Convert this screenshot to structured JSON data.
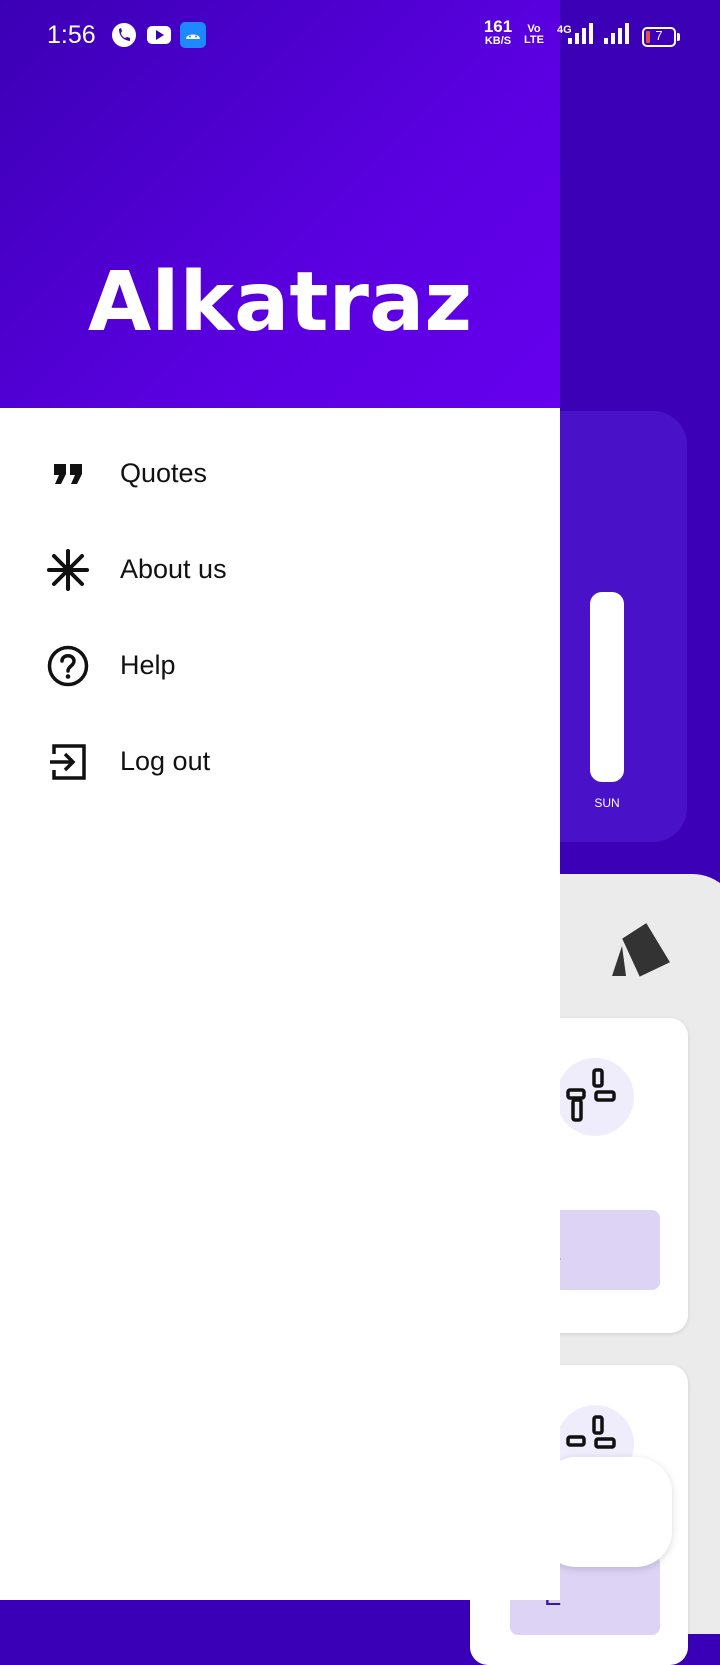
{
  "status_bar": {
    "time": "1:56",
    "network_speed_value": "161",
    "network_speed_unit": "KB/S",
    "volte_top": "Vo",
    "volte_bottom": "LTE",
    "network_type": "4G",
    "battery": "7"
  },
  "drawer": {
    "app_name": "Alkatraz",
    "items": [
      {
        "label": "Quotes",
        "icon": "quote-icon"
      },
      {
        "label": "About us",
        "icon": "asterisk-icon"
      },
      {
        "label": "Help",
        "icon": "help-circle-icon"
      },
      {
        "label": "Log out",
        "icon": "logout-icon"
      }
    ]
  },
  "background": {
    "chart_day_label": "SUN",
    "task_button_letter": "E",
    "task_button_letter_2": "E"
  },
  "colors": {
    "primary": "#3c00b6",
    "header_gradient_end": "#6600ee",
    "accent_light": "#dcd3f5"
  }
}
